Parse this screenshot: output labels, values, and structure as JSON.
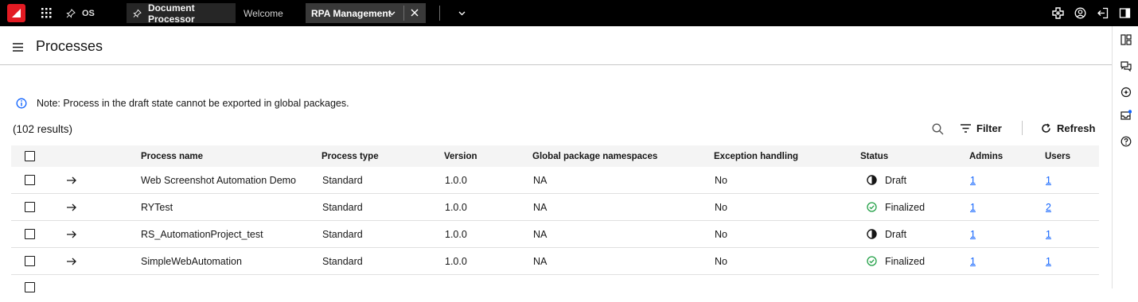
{
  "topbar": {
    "os_label": "OS",
    "tabs": [
      {
        "label": "Document Processor"
      },
      {
        "label": "Welcome"
      },
      {
        "label": "RPA Management"
      }
    ]
  },
  "header": {
    "title": "Processes"
  },
  "note": {
    "text": "Note: Process in the draft state cannot be exported in global packages."
  },
  "results": {
    "text": "(102 results)"
  },
  "toolbar": {
    "filter_label": "Filter",
    "refresh_label": "Refresh"
  },
  "table": {
    "columns": [
      "Process name",
      "Process type",
      "Version",
      "Global package namespaces",
      "Exception handling",
      "Status",
      "Admins",
      "Users"
    ],
    "rows": [
      {
        "name": "Web Screenshot Automation Demo",
        "type": "Standard",
        "version": "1.0.0",
        "namespaces": "NA",
        "exception": "No",
        "status": "Draft",
        "admins": "1",
        "users": "1"
      },
      {
        "name": "RYTest",
        "type": "Standard",
        "version": "1.0.0",
        "namespaces": "NA",
        "exception": "No",
        "status": "Finalized",
        "admins": "1",
        "users": "2"
      },
      {
        "name": "RS_AutomationProject_test",
        "type": "Standard",
        "version": "1.0.0",
        "namespaces": "NA",
        "exception": "No",
        "status": "Draft",
        "admins": "1",
        "users": "1"
      },
      {
        "name": "SimpleWebAutomation",
        "type": "Standard",
        "version": "1.0.0",
        "namespaces": "NA",
        "exception": "No",
        "status": "Finalized",
        "admins": "1",
        "users": "1"
      }
    ]
  },
  "colors": {
    "link": "#0f62fe",
    "finalized": "#24a148",
    "info": "#0f62fe",
    "brand": "#e31b23"
  },
  "icons": [
    "app-grid-icon",
    "pin-icon",
    "chevron-down-icon",
    "close-icon",
    "add-icon",
    "user-avatar-icon",
    "logout-icon",
    "panel-icon",
    "menu-icon",
    "info-icon",
    "search-icon",
    "filter-icon",
    "refresh-icon",
    "arrow-right-icon",
    "draft-status-icon",
    "finalized-status-icon",
    "dashboard-icon",
    "chat-icon",
    "assistant-icon",
    "inbox-icon",
    "help-icon"
  ]
}
